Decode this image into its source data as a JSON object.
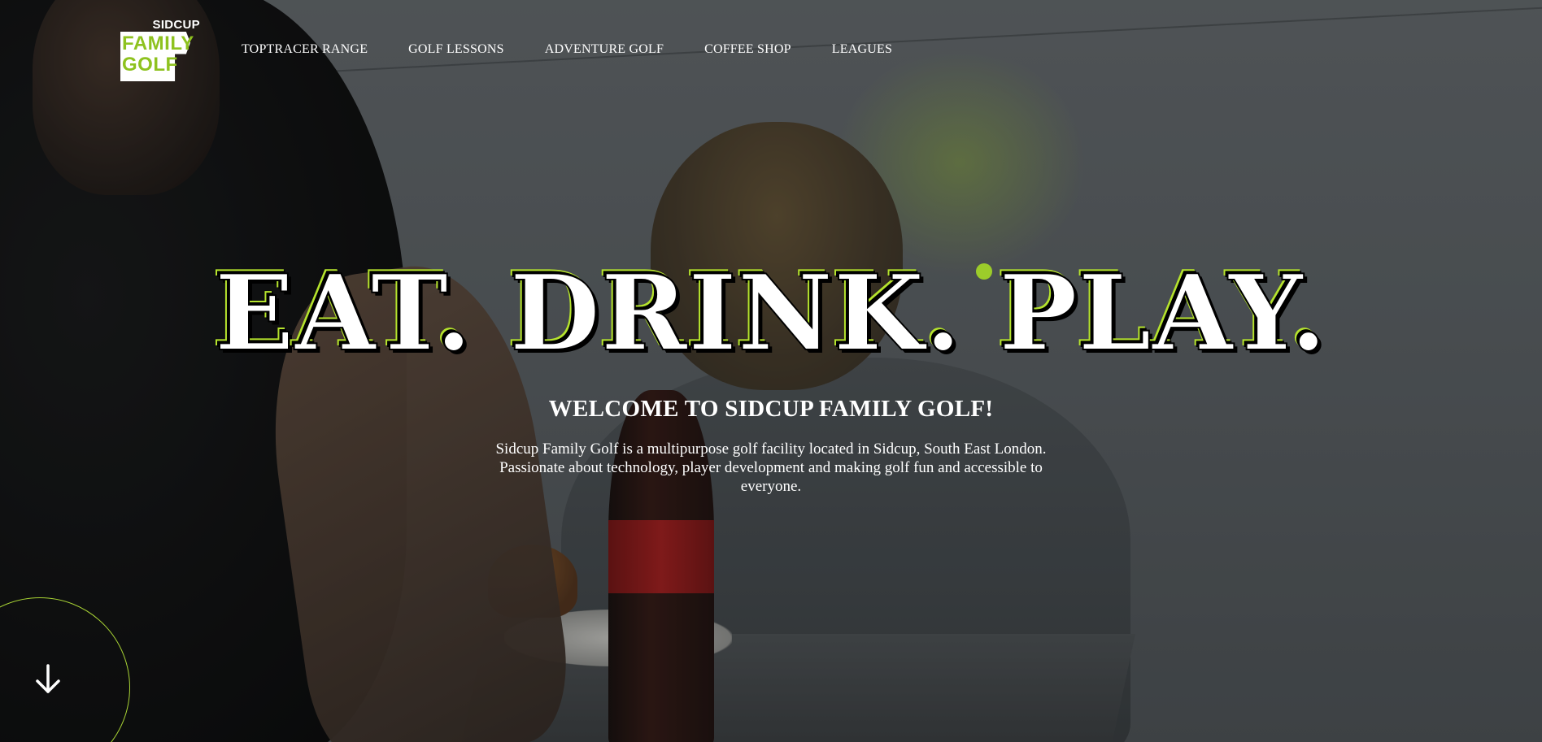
{
  "brand": {
    "logo_top": "SIDCUP",
    "logo_line1": "FAMILY",
    "logo_line2": "GOLF",
    "accent_color": "#8ec21f"
  },
  "nav": {
    "items": [
      {
        "label": "TOPTRACER RANGE"
      },
      {
        "label": "GOLF LESSONS"
      },
      {
        "label": "ADVENTURE GOLF"
      },
      {
        "label": "COFFEE SHOP"
      },
      {
        "label": "LEAGUES"
      }
    ]
  },
  "hero": {
    "headline": "EAT. DRINK. PLAY.",
    "subheading": "WELCOME TO SIDCUP FAMILY GOLF!",
    "intro": "Sidcup Family Golf is a multipurpose golf facility located in Sidcup, South East London. Passionate about technology, player development and making golf fun and accessible to everyone."
  },
  "scroll": {
    "icon": "arrow-down-icon"
  }
}
